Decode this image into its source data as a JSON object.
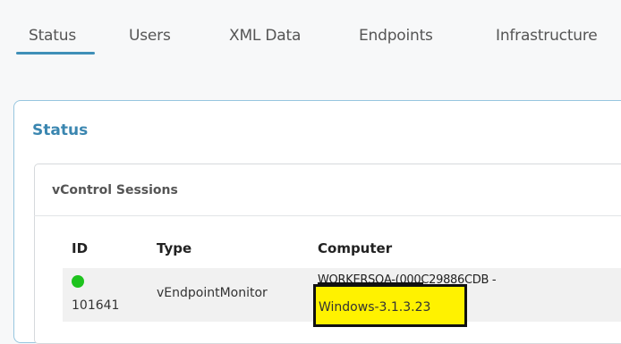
{
  "tabs": [
    {
      "label": "Status"
    },
    {
      "label": "Users"
    },
    {
      "label": "XML Data"
    },
    {
      "label": "Endpoints"
    },
    {
      "label": "Infrastructure"
    }
  ],
  "active_tab": "Status",
  "panel": {
    "title": "Status"
  },
  "sessions_card": {
    "title": "vControl Sessions",
    "columns": [
      "ID",
      "Type",
      "Computer"
    ],
    "rows": [
      {
        "status": "online",
        "status_color": "#1ec31e",
        "id": "101641",
        "type": "vEndpointMonitor",
        "computer_line1_redacted": "WORKERSQA-(000",
        "computer_line1": "C29886CDB -",
        "computer_line2": "Windows-3.1.3.23"
      }
    ]
  },
  "colors": {
    "accent": "#3a86b0",
    "highlight": "#fff200"
  }
}
